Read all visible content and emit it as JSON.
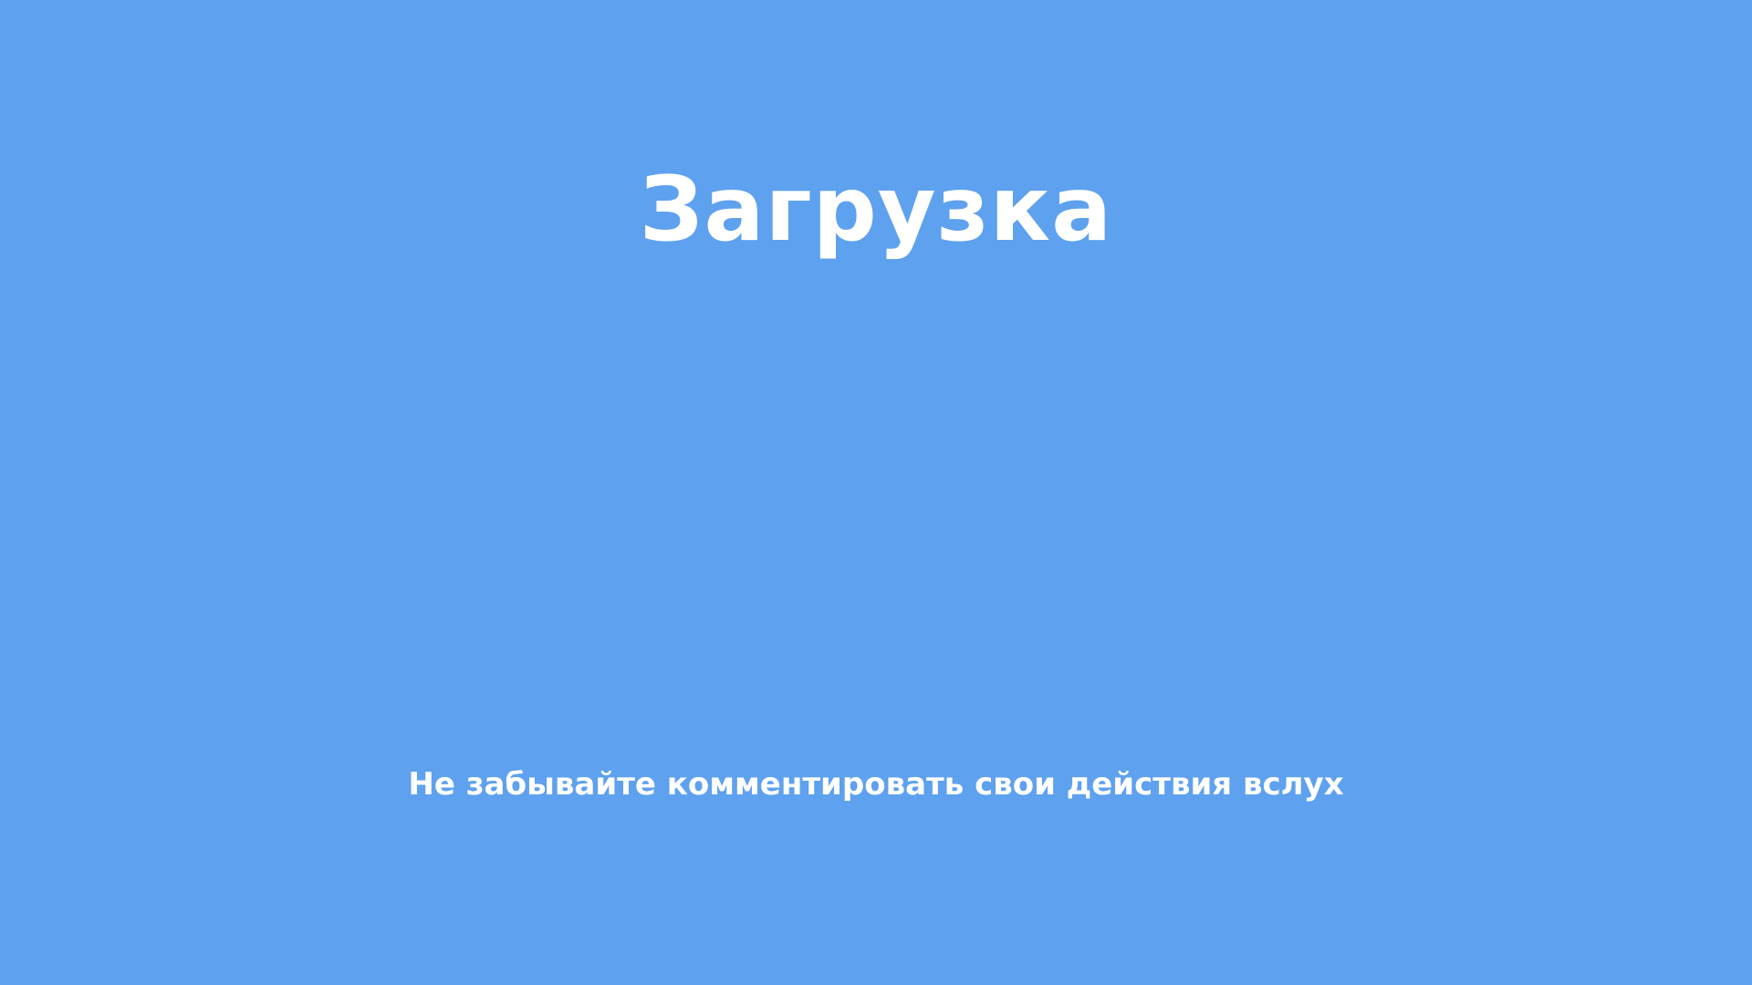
{
  "loading_screen": {
    "title": "Загрузка",
    "hint": "Не забывайте комментировать свои действия вслух",
    "background_color": "#5ea1ee",
    "text_color": "#ffffff"
  }
}
